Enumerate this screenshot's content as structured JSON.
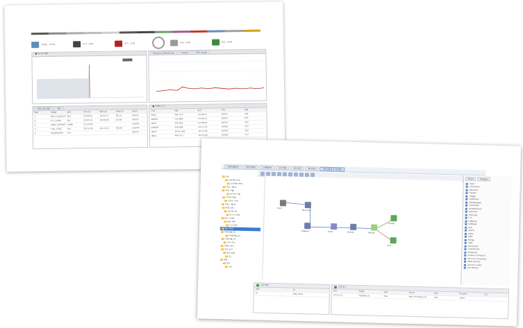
{
  "dashboard": {
    "colorbar": [
      "#555555",
      "#888888",
      "#aaaaaa",
      "#bbbbbb",
      "#cfcfcf",
      "#555555",
      "#444444",
      "#6b9c6b",
      "#9c5a9c",
      "#c0392b",
      "#6a8bbd",
      "#a0a0a0",
      "#d4a017"
    ],
    "kpis": [
      {
        "color": "#5b8fb9",
        "label": "가동중 : 12/18"
      },
      {
        "color": "#444444",
        "label": "대기 : 3/18"
      },
      {
        "color": "#b22222",
        "label": "정지 : 1/18"
      },
      {
        "color": "#999999",
        "label": "점검 : 2/18"
      },
      {
        "color": "#3d8b3d",
        "label": "완료 : 9/18"
      }
    ],
    "left_panel": {
      "title": "■ 실시간 현황"
    },
    "right_tabs": [
      "Resource Monitoring",
      "History",
      "CPU Usage"
    ],
    "table_left": {
      "tabs": [
        "작업 상세 목록",
        "이력"
      ],
      "columns": [
        "번호",
        "작업명",
        "상태",
        "시작시간",
        "종료시간",
        "수행시간",
        "담당자"
      ],
      "rows": [
        [
          "1",
          "BATCH_JOB_01",
          "완료",
          "10:00:01",
          "10:02:11",
          "02:10",
          "admin"
        ],
        [
          "2",
          "ETL_LOAD",
          "완료",
          "10:05:12",
          "10:08:40",
          "03:28",
          "admin"
        ],
        [
          "3",
          "DAILY_REPORT",
          "수행중",
          "10:10:02",
          "",
          "",
          "user01"
        ],
        [
          "4",
          "FILE_SYNC",
          "완료",
          "10:12:33",
          "10:13:01",
          "00:28",
          "user02"
        ],
        [
          "5",
          "DB_BACKUP",
          "대기",
          "",
          "",
          "",
          "admin"
        ]
      ]
    },
    "table_right": {
      "title": "■ 이벤트 로그",
      "columns": [
        "구분",
        "내용",
        "일시",
        "서버",
        "상태"
      ],
      "rows": [
        [
          "INFO",
          "작업 시작",
          "10:00:01",
          "SVR01",
          "정상"
        ],
        [
          "WARN",
          "지연 발생",
          "10:04:22",
          "SVR02",
          "확인"
        ],
        [
          "INFO",
          "작업 완료",
          "10:08:40",
          "SVR01",
          "정상"
        ],
        [
          "ERROR",
          "연결 실패",
          "10:11:05",
          "SVR03",
          "조치"
        ],
        [
          "INFO",
          "재시도 성공",
          "10:12:30",
          "SVR03",
          "정상"
        ],
        [
          "INFO",
          "백업 대기",
          "10:15:00",
          "SVR02",
          "대기"
        ]
      ]
    }
  },
  "designer": {
    "tabs": [
      "작업흐름설계",
      "데이터매핑",
      "스케줄관리",
      "모니터링",
      "로그조회",
      "변수관리",
      "작업흐름설계 (편집중)"
    ],
    "tree": [
      "Job",
      "프로젝트 관리",
      "프로젝트 목록",
      "작업 그룹 A",
      "작업 흐름",
      "데이터 추출",
      "데이터 변환",
      "데이터 적재",
      "작업 그룹 B",
      "파일 전송",
      "DB 동기화",
      "보고서 생성",
      "Job 스케줄",
      "일일 배치",
      "주간 배치",
      "월간 배치",
      "작업흐름_01",
      "작업흐름_02",
      "작업흐름_03",
      "서버 관리",
      "사용자 관리",
      "권한 관리",
      "환경 설정",
      "로그",
      "알림",
      "변수",
      "기타"
    ],
    "tree_selected_index": 15,
    "palette_tabs": [
      "Tools",
      "Shapes"
    ],
    "palette_items": [
      "Start",
      "Connector",
      "Receiver",
      "Sender",
      "Trigger",
      "LoadData",
      "DataMapper",
      "Controller",
      "ScriptRunner",
      "Decision",
      "FileCopy",
      "FTP",
      "DBWrite",
      "DBRead",
      "SQL",
      "Query",
      "Loop",
      "Wait",
      "Merge",
      "Split",
      "RouterJoin",
      "TimerEvent",
      "MailSend",
      "Oracle Connector",
      "Service Connector",
      "Web Service",
      "Service Caller",
      "File Router"
    ],
    "nodes": [
      {
        "label": "Start",
        "color": "#7a7a7a"
      },
      {
        "label": "Receiver",
        "color": "#6c7fa8"
      },
      {
        "label": "Mapper",
        "color": "#6c7fa8"
      },
      {
        "label": "Filter",
        "color": "#8a8acb"
      },
      {
        "label": "Router",
        "color": "#6c7fa8"
      },
      {
        "label": "Merge",
        "color": "#9fd07a"
      },
      {
        "label": "Loader",
        "color": "#5ba85b"
      },
      {
        "label": "End",
        "color": "#5ba85b"
      }
    ],
    "bottom_left": {
      "title": "속성 정보",
      "columns": [
        "항목",
        "값"
      ],
      "rows": [
        [
          "ID",
          "JOB_0012"
        ]
      ]
    },
    "bottom_right": {
      "title": "실행 로그",
      "columns": [
        "일시",
        "작업명",
        "상태",
        "메시지",
        "결과",
        "처리건수",
        "비고"
      ],
      "rows": [
        [
          "10:12:33",
          "작업흐름_01",
          "완료",
          "정상 처리되었습니다",
          "성공",
          "1200",
          "-"
        ]
      ]
    }
  }
}
